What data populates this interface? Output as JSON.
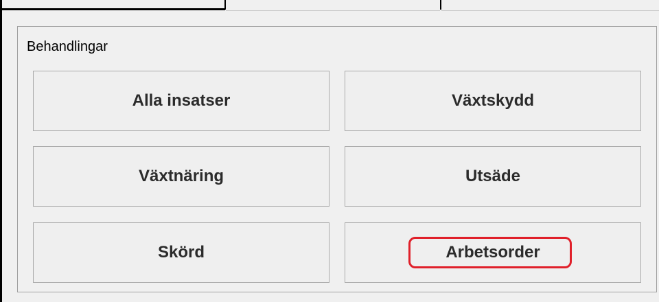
{
  "group": {
    "title": "Behandlingar"
  },
  "buttons": [
    {
      "label": "Alla insatser"
    },
    {
      "label": "Växtskydd"
    },
    {
      "label": "Växtnäring"
    },
    {
      "label": "Utsäde"
    },
    {
      "label": "Skörd"
    },
    {
      "label": "Arbetsorder"
    }
  ],
  "colors": {
    "highlight": "#e0202a",
    "background": "#f0f0f0",
    "button_border": "#a9a9a9"
  }
}
